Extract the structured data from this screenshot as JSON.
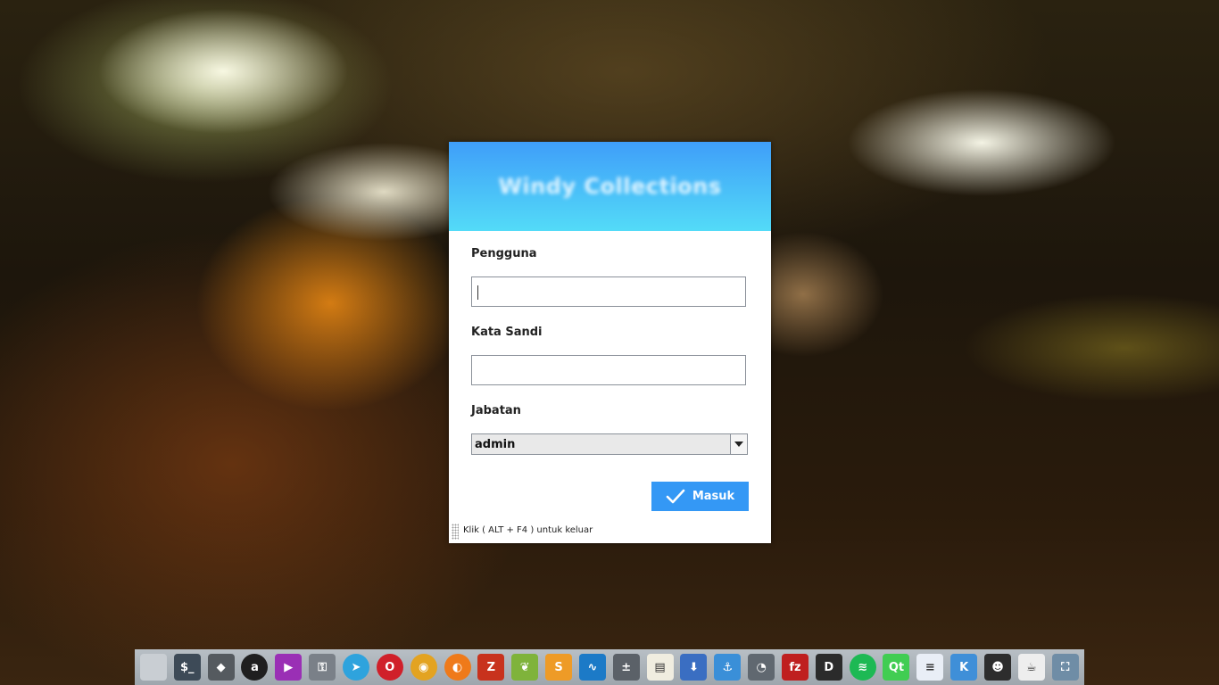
{
  "login": {
    "title": "Windy Collections",
    "username_label": "Pengguna",
    "username_value": "",
    "password_label": "Kata Sandi",
    "password_value": "",
    "role_label": "Jabatan",
    "role_selected": "admin",
    "submit_label": "Masuk",
    "exit_hint": "Klik ( ALT + F4 ) untuk keluar"
  },
  "colors": {
    "header_top": "#3f9ef9",
    "header_bottom": "#53dbf8",
    "button": "#3498f5"
  },
  "dock": {
    "items": [
      {
        "name": "files-icon",
        "glyph": "",
        "bg": "#c9ced3"
      },
      {
        "name": "terminal-icon",
        "glyph": "$_",
        "bg": "#3d4a57"
      },
      {
        "name": "inkscape-icon",
        "glyph": "◆",
        "bg": "#555a5f"
      },
      {
        "name": "amazon-icon",
        "glyph": "a",
        "bg": "#1f1f1f"
      },
      {
        "name": "media-player-icon",
        "glyph": "▶",
        "bg": "#9a2fb5"
      },
      {
        "name": "key-icon",
        "glyph": "⚿",
        "bg": "#7a8088"
      },
      {
        "name": "telegram-icon",
        "glyph": "➤",
        "bg": "#2ea3dd"
      },
      {
        "name": "opera-icon",
        "glyph": "O",
        "bg": "#d0202a"
      },
      {
        "name": "chrome-icon",
        "glyph": "◉",
        "bg": "#e3a321"
      },
      {
        "name": "firefox-icon",
        "glyph": "◐",
        "bg": "#ef7a1a"
      },
      {
        "name": "filezilla-z-icon",
        "glyph": "Z",
        "bg": "#c8321d"
      },
      {
        "name": "leaf-icon",
        "glyph": "❦",
        "bg": "#7fb33b"
      },
      {
        "name": "sublime-icon",
        "glyph": "S",
        "bg": "#ee9b27"
      },
      {
        "name": "monitor-icon",
        "glyph": "∿",
        "bg": "#1c7ac7"
      },
      {
        "name": "calculator-icon",
        "glyph": "±",
        "bg": "#5b6168"
      },
      {
        "name": "notes-icon",
        "glyph": "▤",
        "bg": "#f0ede0"
      },
      {
        "name": "download-icon",
        "glyph": "⬇",
        "bg": "#3a6ec2"
      },
      {
        "name": "anchor-icon",
        "glyph": "⚓",
        "bg": "#3a8fd8"
      },
      {
        "name": "disk-icon",
        "glyph": "◔",
        "bg": "#606870"
      },
      {
        "name": "filezilla-icon",
        "glyph": "fz",
        "bg": "#bf1f1f"
      },
      {
        "name": "dev-icon",
        "glyph": "D",
        "bg": "#2b2b2b"
      },
      {
        "name": "spotify-icon",
        "glyph": "≋",
        "bg": "#1db954"
      },
      {
        "name": "qt-icon",
        "glyph": "Qt",
        "bg": "#41cd52"
      },
      {
        "name": "document-icon",
        "glyph": "≡",
        "bg": "#e9eef6"
      },
      {
        "name": "kbbi-icon",
        "glyph": "K",
        "bg": "#3f8fd8"
      },
      {
        "name": "hacker-icon",
        "glyph": "☻",
        "bg": "#2d2d2d"
      },
      {
        "name": "java-icon",
        "glyph": "☕",
        "bg": "#eeeeee"
      },
      {
        "name": "screenshot-icon",
        "glyph": "⛶",
        "bg": "#6f8da6"
      }
    ]
  }
}
